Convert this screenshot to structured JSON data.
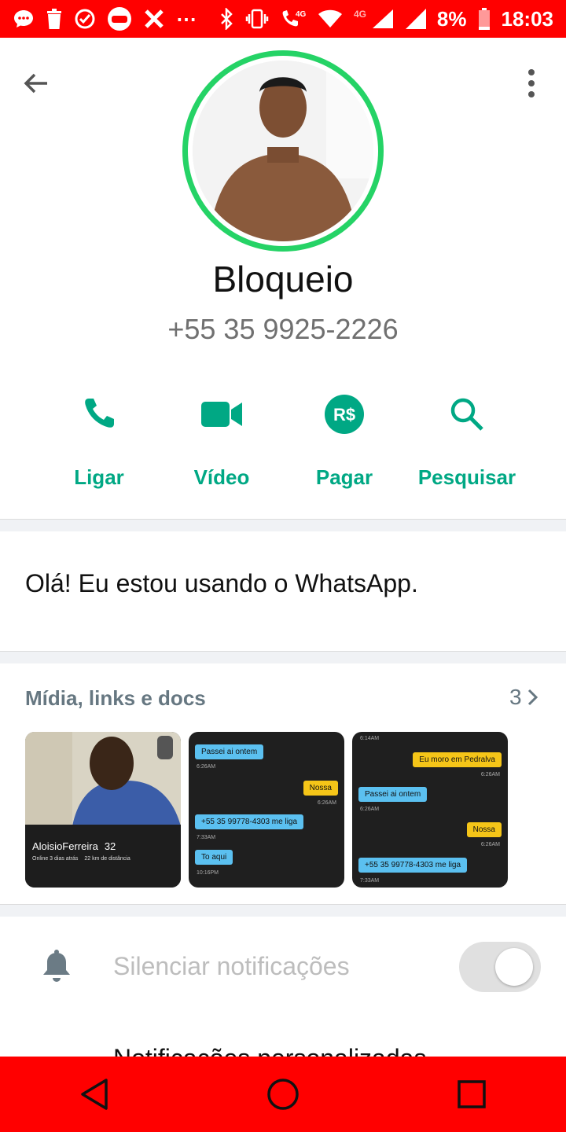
{
  "status_bar": {
    "battery": "8%",
    "time": "18:03",
    "network": "4G",
    "overflow": "⋯"
  },
  "contact": {
    "name": "Bloqueio",
    "phone": "+55 35 9925-2226"
  },
  "actions": [
    {
      "label": "Ligar",
      "icon": "phone-icon"
    },
    {
      "label": "Vídeo",
      "icon": "video-icon"
    },
    {
      "label": "Pagar",
      "icon": "payment-icon",
      "glyph": "R$"
    },
    {
      "label": "Pesquisar",
      "icon": "search-icon"
    }
  ],
  "about": "Olá! Eu estou usando o WhatsApp.",
  "media": {
    "title": "Mídia, links e docs",
    "count": "3",
    "thumb1": {
      "name": "AloisioFerreira",
      "age": "32",
      "status": "Online 3 dias atrás",
      "distance": "22 km de distância"
    },
    "thumb2": [
      {
        "text": "Passei ai ontem",
        "time": "6:26AM"
      },
      {
        "text": "Nossa",
        "time": "6:26AM"
      },
      {
        "text": "+55 35 99778-4303 me liga",
        "time": "7:33AM"
      },
      {
        "text": "To aqui",
        "time": "10:16PM"
      }
    ],
    "thumb3": [
      {
        "text": "",
        "time": "6:14AM"
      },
      {
        "text": "Eu moro em Pedralva",
        "time": "6:26AM"
      },
      {
        "text": "Passei ai ontem",
        "time": "6:26AM"
      },
      {
        "text": "Nossa",
        "time": "6:26AM"
      },
      {
        "text": "+55 35 99778-4303 me liga",
        "time": "7:33AM"
      }
    ]
  },
  "notifications": {
    "mute_label": "Silenciar notificações",
    "mute_enabled": false,
    "next_row_label": "Notificações personalizadas"
  },
  "colors": {
    "accent": "#00a884",
    "ring": "#25d366",
    "status_bar": "#ff0000"
  }
}
